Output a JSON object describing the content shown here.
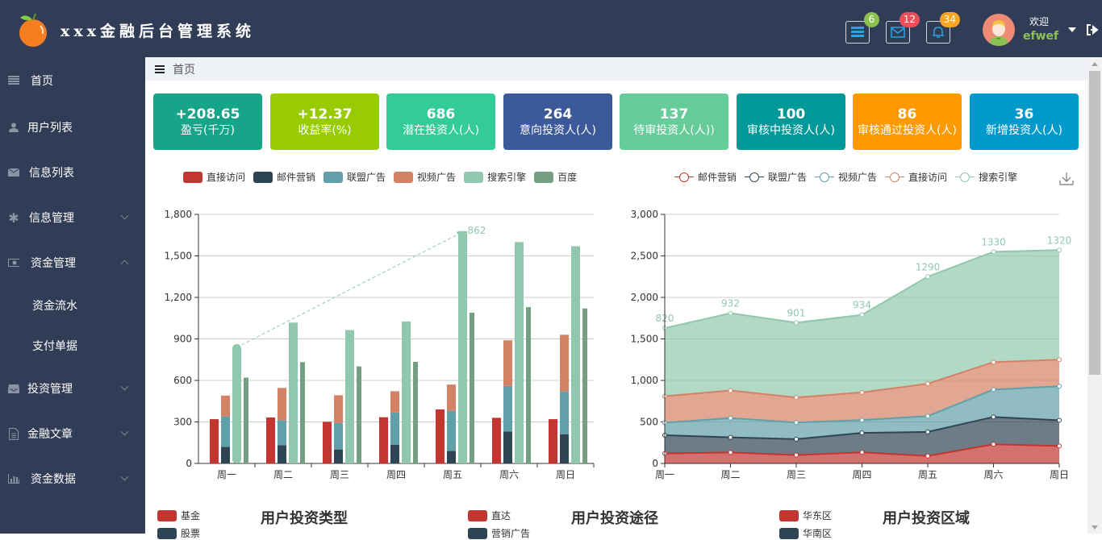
{
  "header": {
    "app_title": "xxx金融后台管理系统",
    "icons": [
      {
        "name": "server-icon",
        "badge": "6",
        "badge_color": "#8cc152"
      },
      {
        "name": "mail-icon",
        "badge": "12",
        "badge_color": "#e9505a"
      },
      {
        "name": "bell-icon",
        "badge": "34",
        "badge_color": "#f6a623"
      }
    ],
    "welcome": "欢迎",
    "username": "efwef"
  },
  "sidebar": {
    "items": [
      {
        "label": "首页",
        "icon": "list-icon",
        "expandable": false
      },
      {
        "label": "用户列表",
        "icon": "user-icon",
        "expandable": false
      },
      {
        "label": "信息列表",
        "icon": "envelope-icon",
        "expandable": false
      },
      {
        "label": "信息管理",
        "icon": "asterisk-icon",
        "expandable": true,
        "expanded": false
      },
      {
        "label": "资金管理",
        "icon": "money-icon",
        "expandable": true,
        "expanded": true
      },
      {
        "label": "投资管理",
        "icon": "inbox-icon",
        "expandable": true,
        "expanded": false
      },
      {
        "label": "金融文章",
        "icon": "document-icon",
        "expandable": true,
        "expanded": false
      },
      {
        "label": "资金数据",
        "icon": "bar-chart-icon",
        "expandable": true,
        "expanded": false
      }
    ],
    "subitems": [
      {
        "label": "资金流水"
      },
      {
        "label": "支付单据"
      }
    ]
  },
  "breadcrumb": {
    "current": "首页"
  },
  "cards": [
    {
      "value": "+208.65",
      "label": "盈亏(千万)",
      "color": "#17a589"
    },
    {
      "value": "+12.37",
      "label": "收益率(%)",
      "color": "#99cc00"
    },
    {
      "value": "686",
      "label": "潜在投资人(人)",
      "color": "#33cc99"
    },
    {
      "value": "264",
      "label": "意向投资人(人)",
      "color": "#3c5a99"
    },
    {
      "value": "137",
      "label": "待审投资人(人))",
      "color": "#66cc99"
    },
    {
      "value": "100",
      "label": "审核中投资人(人)",
      "color": "#009999"
    },
    {
      "value": "86",
      "label": "审核通过投资人(人)",
      "color": "#ff9900"
    },
    {
      "value": "36",
      "label": "新增投资人(人)",
      "color": "#0099cc"
    }
  ],
  "chart_data": [
    {
      "type": "bar",
      "title": "",
      "categories": [
        "周一",
        "周二",
        "周三",
        "周四",
        "周五",
        "周六",
        "周日"
      ],
      "ylim": [
        0,
        1800
      ],
      "yticks": [
        "0",
        "300",
        "600",
        "900",
        "1,200",
        "1,500",
        "1,800"
      ],
      "grid": true,
      "legend_position": "top",
      "series": [
        {
          "name": "直接访问",
          "color": "#c23531",
          "stack": null,
          "values": [
            320,
            332,
            301,
            334,
            390,
            330,
            320
          ]
        },
        {
          "name": "邮件营销",
          "color": "#2f4554",
          "stack": "广告",
          "values": [
            120,
            132,
            101,
            134,
            90,
            230,
            210
          ]
        },
        {
          "name": "联盟广告",
          "color": "#61a0a8",
          "stack": "广告",
          "values": [
            220,
            182,
            191,
            234,
            290,
            330,
            310
          ]
        },
        {
          "name": "视频广告",
          "color": "#d48265",
          "stack": "广告",
          "values": [
            150,
            232,
            201,
            154,
            190,
            330,
            410
          ]
        },
        {
          "name": "搜索引擎",
          "color": "#91c7ae",
          "stack": null,
          "values": [
            862,
            1018,
            964,
            1026,
            1679,
            1600,
            1570
          ]
        },
        {
          "name": "百度",
          "color": "#749f83",
          "stack": null,
          "values": [
            620,
            732,
            701,
            734,
            1090,
            1130,
            1120
          ]
        }
      ],
      "annotation": {
        "text": "862",
        "from": "周一",
        "to": "周五",
        "style": "dashed-arrow"
      }
    },
    {
      "type": "area",
      "title": "",
      "categories": [
        "周一",
        "周二",
        "周三",
        "周四",
        "周五",
        "周六",
        "周日"
      ],
      "ylim": [
        0,
        3000
      ],
      "yticks": [
        "0",
        "500",
        "1,000",
        "1,500",
        "2,000",
        "2,500",
        "3,000"
      ],
      "grid": true,
      "stacked": true,
      "legend_position": "top-right",
      "series": [
        {
          "name": "邮件营销",
          "color": "#c23531",
          "values": [
            120,
            132,
            101,
            134,
            90,
            230,
            210
          ]
        },
        {
          "name": "联盟广告",
          "color": "#2f4554",
          "values": [
            220,
            182,
            191,
            234,
            290,
            330,
            310
          ]
        },
        {
          "name": "视频广告",
          "color": "#61a0a8",
          "values": [
            150,
            232,
            201,
            154,
            190,
            330,
            410
          ]
        },
        {
          "name": "直接访问",
          "color": "#d48265",
          "values": [
            320,
            332,
            301,
            334,
            390,
            330,
            320
          ]
        },
        {
          "name": "搜索引擎",
          "color": "#91c7ae",
          "values": [
            820,
            932,
            901,
            934,
            1290,
            1330,
            1320
          ],
          "show_labels": true
        }
      ]
    }
  ],
  "bottom_panels": [
    {
      "title": "用户投资类型",
      "legend": [
        {
          "label": "基金",
          "color": "#c23531"
        },
        {
          "label": "股票",
          "color": "#2f4554"
        }
      ]
    },
    {
      "title": "用户投资途径",
      "legend": [
        {
          "label": "直达",
          "color": "#c23531"
        },
        {
          "label": "营销广告",
          "color": "#2f4554"
        }
      ]
    },
    {
      "title": "用户投资区域",
      "legend": [
        {
          "label": "华东区",
          "color": "#c23531"
        },
        {
          "label": "华南区",
          "color": "#2f4554"
        }
      ]
    }
  ]
}
